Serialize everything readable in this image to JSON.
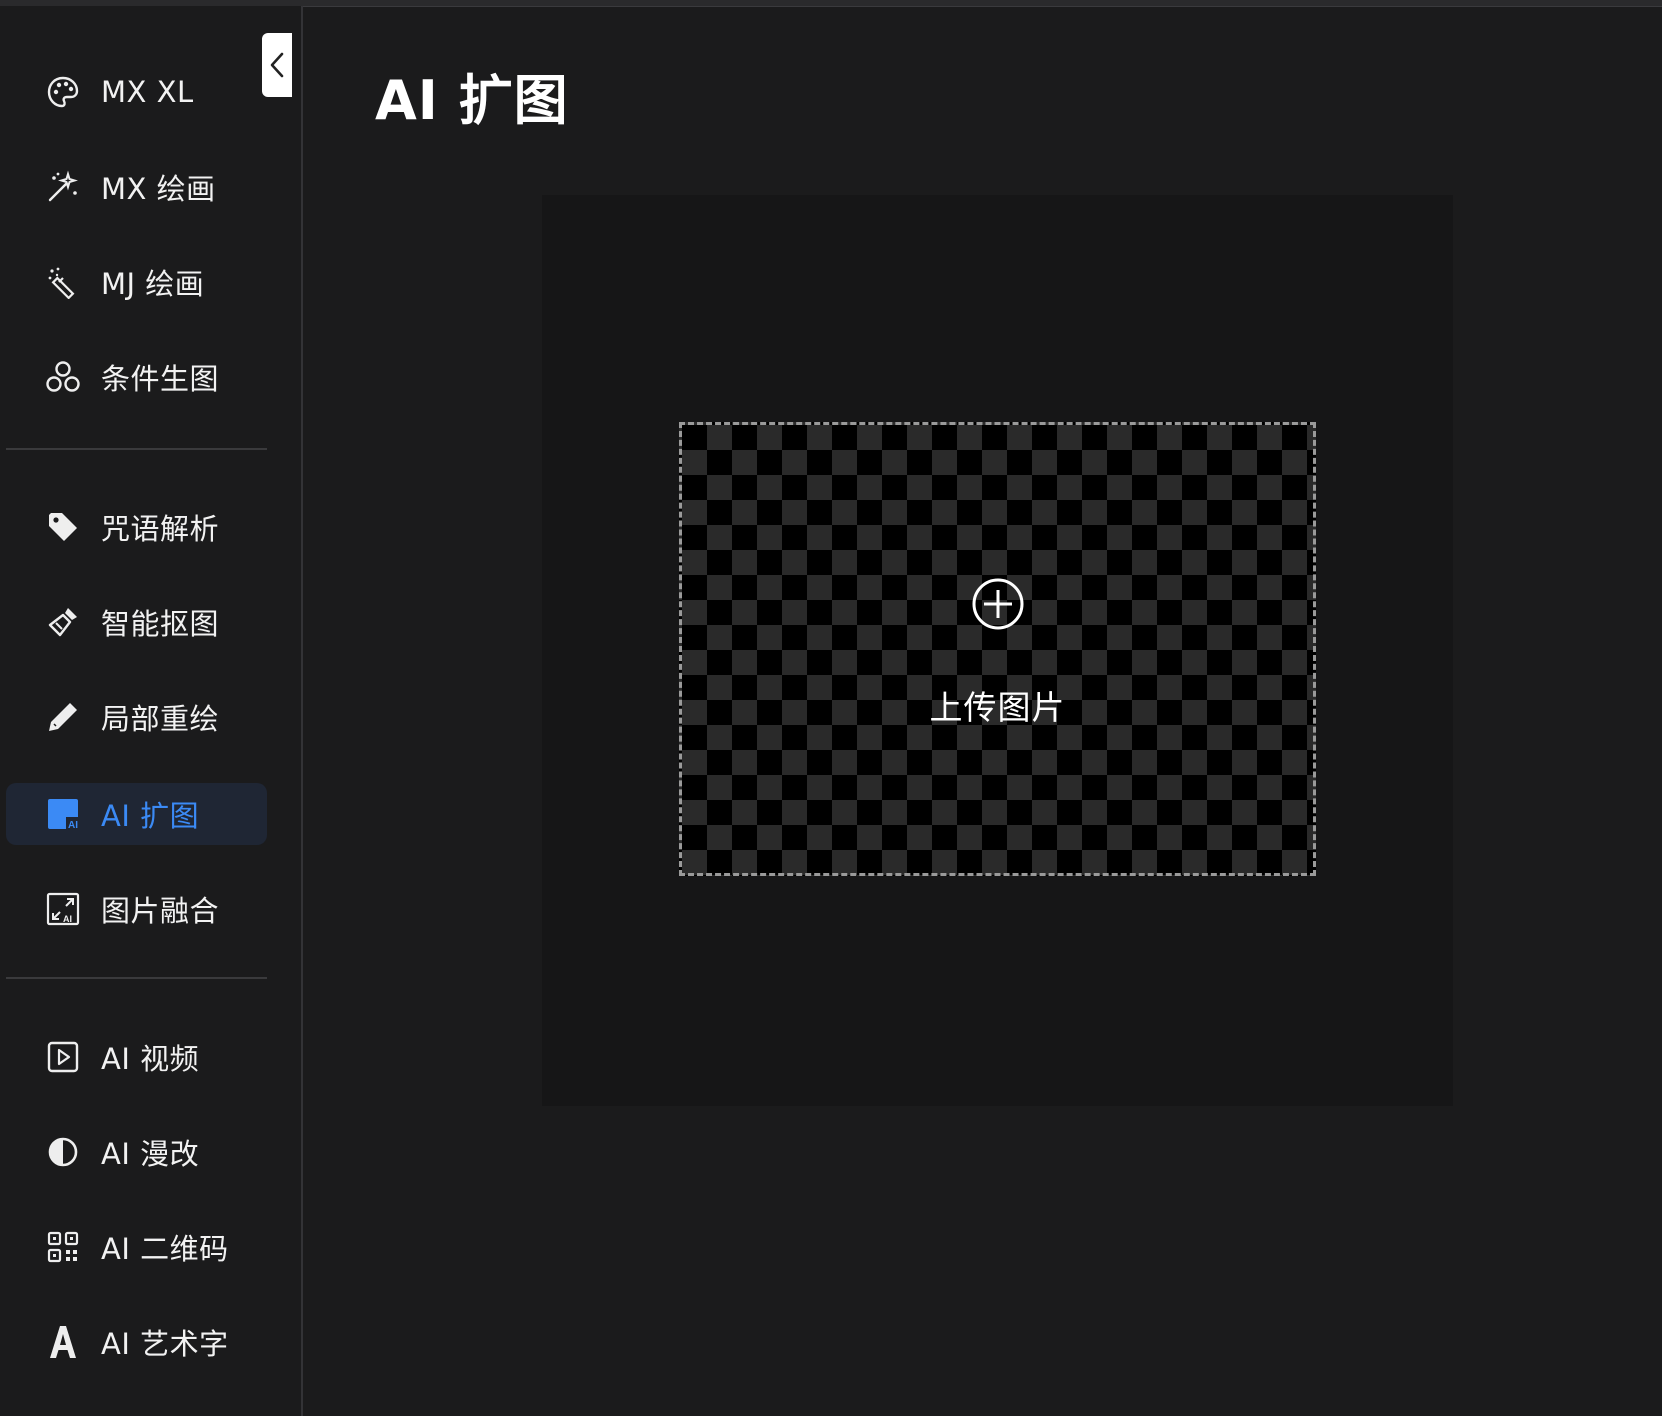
{
  "sidebar": {
    "groups": [
      {
        "items": [
          {
            "label": "MX XL",
            "icon": "palette-icon"
          },
          {
            "label": "MX 绘画",
            "icon": "magic-sparkle-icon"
          },
          {
            "label": "MJ 绘画",
            "icon": "magic-wand-icon"
          },
          {
            "label": "条件生图",
            "icon": "three-circles-icon"
          }
        ]
      },
      {
        "items": [
          {
            "label": "咒语解析",
            "icon": "tag-icon"
          },
          {
            "label": "智能抠图",
            "icon": "eraser-brush-icon"
          },
          {
            "label": "局部重绘",
            "icon": "pencil-icon"
          },
          {
            "label": "AI 扩图",
            "icon": "ai-expand-icon",
            "active": true
          },
          {
            "label": "图片融合",
            "icon": "ai-merge-icon"
          }
        ]
      },
      {
        "items": [
          {
            "label": "AI 视频",
            "icon": "video-play-icon"
          },
          {
            "label": "AI 漫改",
            "icon": "half-circle-icon"
          },
          {
            "label": "AI 二维码",
            "icon": "qr-code-icon"
          },
          {
            "label": "AI 艺术字",
            "icon": "letter-a-icon"
          }
        ]
      }
    ],
    "active_color": "#3b8af5"
  },
  "main": {
    "title": "AI 扩图",
    "upload": {
      "label": "上传图片",
      "icon": "plus-circle-icon"
    }
  },
  "theme": {
    "background": "#1b1b1c",
    "panel": "#161617"
  }
}
